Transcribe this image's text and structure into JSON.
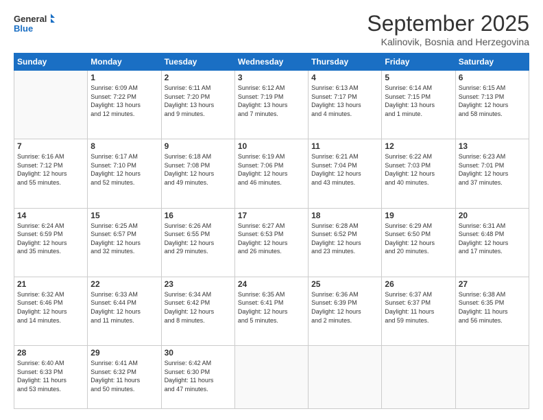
{
  "logo": {
    "line1": "General",
    "line2": "Blue"
  },
  "title": "September 2025",
  "location": "Kalinovik, Bosnia and Herzegovina",
  "weekdays": [
    "Sunday",
    "Monday",
    "Tuesday",
    "Wednesday",
    "Thursday",
    "Friday",
    "Saturday"
  ],
  "weeks": [
    [
      {
        "day": "",
        "info": ""
      },
      {
        "day": "1",
        "info": "Sunrise: 6:09 AM\nSunset: 7:22 PM\nDaylight: 13 hours\nand 12 minutes."
      },
      {
        "day": "2",
        "info": "Sunrise: 6:11 AM\nSunset: 7:20 PM\nDaylight: 13 hours\nand 9 minutes."
      },
      {
        "day": "3",
        "info": "Sunrise: 6:12 AM\nSunset: 7:19 PM\nDaylight: 13 hours\nand 7 minutes."
      },
      {
        "day": "4",
        "info": "Sunrise: 6:13 AM\nSunset: 7:17 PM\nDaylight: 13 hours\nand 4 minutes."
      },
      {
        "day": "5",
        "info": "Sunrise: 6:14 AM\nSunset: 7:15 PM\nDaylight: 13 hours\nand 1 minute."
      },
      {
        "day": "6",
        "info": "Sunrise: 6:15 AM\nSunset: 7:13 PM\nDaylight: 12 hours\nand 58 minutes."
      }
    ],
    [
      {
        "day": "7",
        "info": "Sunrise: 6:16 AM\nSunset: 7:12 PM\nDaylight: 12 hours\nand 55 minutes."
      },
      {
        "day": "8",
        "info": "Sunrise: 6:17 AM\nSunset: 7:10 PM\nDaylight: 12 hours\nand 52 minutes."
      },
      {
        "day": "9",
        "info": "Sunrise: 6:18 AM\nSunset: 7:08 PM\nDaylight: 12 hours\nand 49 minutes."
      },
      {
        "day": "10",
        "info": "Sunrise: 6:19 AM\nSunset: 7:06 PM\nDaylight: 12 hours\nand 46 minutes."
      },
      {
        "day": "11",
        "info": "Sunrise: 6:21 AM\nSunset: 7:04 PM\nDaylight: 12 hours\nand 43 minutes."
      },
      {
        "day": "12",
        "info": "Sunrise: 6:22 AM\nSunset: 7:03 PM\nDaylight: 12 hours\nand 40 minutes."
      },
      {
        "day": "13",
        "info": "Sunrise: 6:23 AM\nSunset: 7:01 PM\nDaylight: 12 hours\nand 37 minutes."
      }
    ],
    [
      {
        "day": "14",
        "info": "Sunrise: 6:24 AM\nSunset: 6:59 PM\nDaylight: 12 hours\nand 35 minutes."
      },
      {
        "day": "15",
        "info": "Sunrise: 6:25 AM\nSunset: 6:57 PM\nDaylight: 12 hours\nand 32 minutes."
      },
      {
        "day": "16",
        "info": "Sunrise: 6:26 AM\nSunset: 6:55 PM\nDaylight: 12 hours\nand 29 minutes."
      },
      {
        "day": "17",
        "info": "Sunrise: 6:27 AM\nSunset: 6:53 PM\nDaylight: 12 hours\nand 26 minutes."
      },
      {
        "day": "18",
        "info": "Sunrise: 6:28 AM\nSunset: 6:52 PM\nDaylight: 12 hours\nand 23 minutes."
      },
      {
        "day": "19",
        "info": "Sunrise: 6:29 AM\nSunset: 6:50 PM\nDaylight: 12 hours\nand 20 minutes."
      },
      {
        "day": "20",
        "info": "Sunrise: 6:31 AM\nSunset: 6:48 PM\nDaylight: 12 hours\nand 17 minutes."
      }
    ],
    [
      {
        "day": "21",
        "info": "Sunrise: 6:32 AM\nSunset: 6:46 PM\nDaylight: 12 hours\nand 14 minutes."
      },
      {
        "day": "22",
        "info": "Sunrise: 6:33 AM\nSunset: 6:44 PM\nDaylight: 12 hours\nand 11 minutes."
      },
      {
        "day": "23",
        "info": "Sunrise: 6:34 AM\nSunset: 6:42 PM\nDaylight: 12 hours\nand 8 minutes."
      },
      {
        "day": "24",
        "info": "Sunrise: 6:35 AM\nSunset: 6:41 PM\nDaylight: 12 hours\nand 5 minutes."
      },
      {
        "day": "25",
        "info": "Sunrise: 6:36 AM\nSunset: 6:39 PM\nDaylight: 12 hours\nand 2 minutes."
      },
      {
        "day": "26",
        "info": "Sunrise: 6:37 AM\nSunset: 6:37 PM\nDaylight: 11 hours\nand 59 minutes."
      },
      {
        "day": "27",
        "info": "Sunrise: 6:38 AM\nSunset: 6:35 PM\nDaylight: 11 hours\nand 56 minutes."
      }
    ],
    [
      {
        "day": "28",
        "info": "Sunrise: 6:40 AM\nSunset: 6:33 PM\nDaylight: 11 hours\nand 53 minutes."
      },
      {
        "day": "29",
        "info": "Sunrise: 6:41 AM\nSunset: 6:32 PM\nDaylight: 11 hours\nand 50 minutes."
      },
      {
        "day": "30",
        "info": "Sunrise: 6:42 AM\nSunset: 6:30 PM\nDaylight: 11 hours\nand 47 minutes."
      },
      {
        "day": "",
        "info": ""
      },
      {
        "day": "",
        "info": ""
      },
      {
        "day": "",
        "info": ""
      },
      {
        "day": "",
        "info": ""
      }
    ]
  ]
}
